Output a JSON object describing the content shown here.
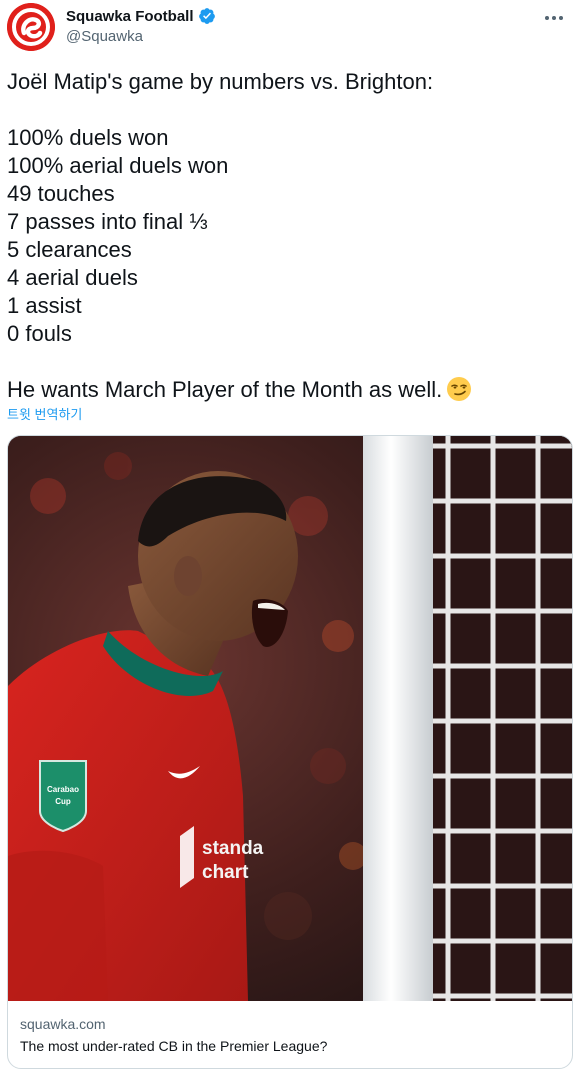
{
  "header": {
    "display_name": "Squawka Football",
    "handle": "@Squawka",
    "verified": true,
    "more_icon": "more-horizontal-icon"
  },
  "tweet": {
    "headline": "Joël Matip's game by numbers vs. Brighton:",
    "stats": [
      "100% duels won",
      "100% aerial duels won",
      "49 touches",
      "7 passes into final ⅓",
      "5 clearances",
      "4 aerial duels",
      "1 assist",
      "0 fouls"
    ],
    "closing": "He wants March Player of the Month as well.",
    "emoji": "smirking-face-emoji",
    "translate_label": "트윗 번역하기"
  },
  "card": {
    "image": "liverpool-player-celebrating-photo",
    "badge_text": "Carabao Cup",
    "sponsor_text": "standard chartered",
    "domain": "squawka.com",
    "title": "The most under-rated CB in the Premier League?"
  },
  "colors": {
    "brand_red": "#e0201b",
    "link_blue": "#1d9bf0",
    "text_primary": "#0f1419",
    "text_secondary": "#536471",
    "card_border": "#cfd9de"
  }
}
